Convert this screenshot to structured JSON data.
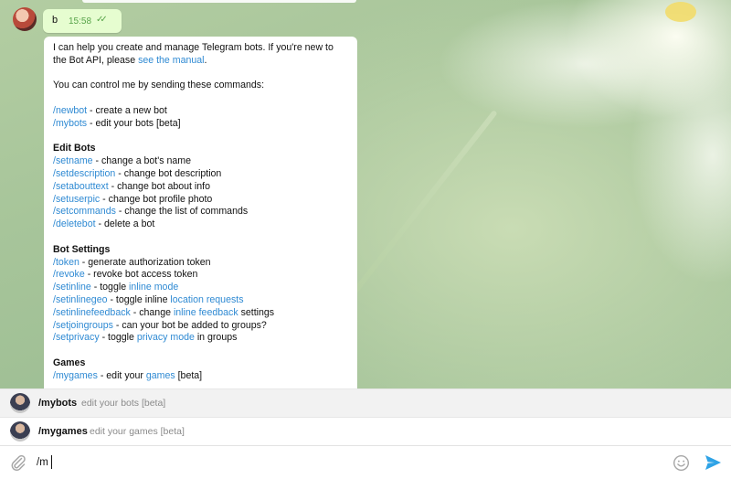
{
  "outgoing": {
    "text": "b",
    "time": "15:58",
    "status": "read"
  },
  "bot_message": {
    "intro_1": "I can help you create and manage Telegram bots. If you're new to",
    "intro_2_prefix": "the Bot API, please ",
    "intro_2_link": "see the manual",
    "intro_2_suffix": ".",
    "control_line": "You can control me by sending these commands:",
    "top_commands": [
      {
        "cmd": "/newbot",
        "desc": " - create a new bot"
      },
      {
        "cmd": "/mybots",
        "desc": " - edit your bots [beta]"
      }
    ],
    "edit_bots_title": "Edit Bots",
    "edit_bots": [
      {
        "cmd": "/setname",
        "desc": " - change a bot's name"
      },
      {
        "cmd": "/setdescription",
        "desc": " - change bot description"
      },
      {
        "cmd": "/setabouttext",
        "desc": " - change bot about info"
      },
      {
        "cmd": "/setuserpic",
        "desc": " - change bot profile photo"
      },
      {
        "cmd": "/setcommands",
        "desc": " - change the list of commands"
      },
      {
        "cmd": "/deletebot",
        "desc": " - delete a bot"
      }
    ],
    "bot_settings_title": "Bot Settings",
    "bot_settings": [
      {
        "cmd": "/token",
        "desc": " - generate authorization token"
      },
      {
        "cmd": "/revoke",
        "desc": " - revoke bot access token"
      },
      {
        "cmd": "/setinline",
        "desc_pre": " - toggle ",
        "link": "inline mode",
        "desc_post": ""
      },
      {
        "cmd": "/setinlinegeo",
        "desc_pre": " - toggle inline ",
        "link": "location requests",
        "desc_post": ""
      },
      {
        "cmd": "/setinlinefeedback",
        "desc_pre": " - change ",
        "link": "inline feedback",
        "desc_post": " settings"
      },
      {
        "cmd": "/setjoingroups",
        "desc_pre": " - can your bot be added to groups?",
        "link": "",
        "desc_post": ""
      },
      {
        "cmd": "/setprivacy",
        "desc_pre": " - toggle ",
        "link": "privacy mode",
        "desc_post": " in groups"
      }
    ],
    "games_title": "Games",
    "games": [
      {
        "cmd": "/mygames",
        "desc_pre": " - edit your ",
        "link": "games",
        "desc_post": " [beta]"
      }
    ]
  },
  "suggestions": [
    {
      "cmd": "/mybots",
      "desc": "edit your bots [beta]"
    },
    {
      "cmd": "/mygames",
      "desc": "edit your games [beta]"
    }
  ],
  "input": {
    "value": "/m"
  },
  "icons": {
    "attach": "paperclip-icon",
    "emoji": "smile-icon",
    "send": "send-icon"
  },
  "colors": {
    "link": "#2f8ad3",
    "outgoing_bg": "#e6fdd0",
    "time": "#58a44a",
    "send": "#2fa3e6"
  }
}
